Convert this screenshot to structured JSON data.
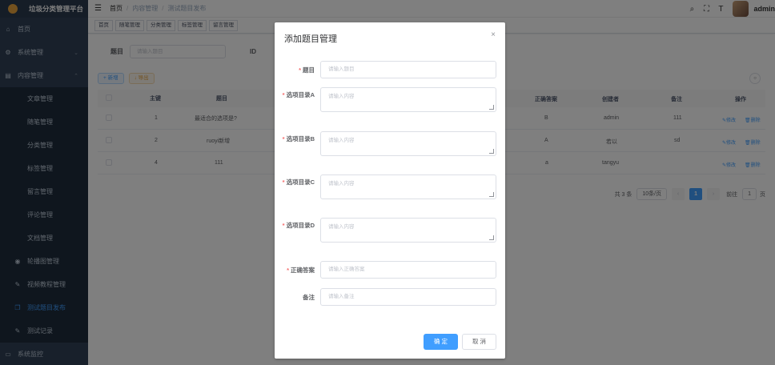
{
  "app": {
    "title": "垃圾分类管理平台"
  },
  "sidebar": {
    "items": [
      {
        "label": "首页",
        "icon": "home-icon"
      },
      {
        "label": "系统管理",
        "icon": "gear-icon"
      },
      {
        "label": "内容管理",
        "icon": "doc-icon"
      },
      {
        "label": "文章管理"
      },
      {
        "label": "随笔管理"
      },
      {
        "label": "分类管理"
      },
      {
        "label": "标签管理"
      },
      {
        "label": "留言管理"
      },
      {
        "label": "评论管理"
      },
      {
        "label": "文档管理"
      },
      {
        "label": "轮播图管理",
        "icon": "image-icon"
      },
      {
        "label": "视频教程管理",
        "icon": "video-icon"
      },
      {
        "label": "测试题目发布",
        "icon": "copy-icon"
      },
      {
        "label": "测试记录",
        "icon": "record-icon"
      },
      {
        "label": "系统监控",
        "icon": "monitor-icon"
      }
    ]
  },
  "navbar": {
    "breadcrumb": [
      "首页",
      "内容管理",
      "测试题目发布"
    ],
    "user": "admin"
  },
  "tags": [
    "首页",
    "随笔管理",
    "分类管理",
    "标签管理",
    "留言管理"
  ],
  "search": {
    "label_title": "题目",
    "placeholder_title": "请输入题目",
    "label_id": "ID"
  },
  "toolbar": {
    "add": "+ 新增",
    "export": "↓ 导出"
  },
  "table": {
    "headers": [
      "主键",
      "题目",
      "正确答案",
      "创建者",
      "备注",
      "操作"
    ],
    "rows": [
      {
        "id": "1",
        "title": "最适合的选项是?",
        "answer": "B",
        "creator": "admin",
        "remark": "111"
      },
      {
        "id": "2",
        "title": "ruoyi新增",
        "answer": "A",
        "creator": "若以",
        "remark": "sd"
      },
      {
        "id": "4",
        "title": "111",
        "answer": "a",
        "creator": "tangyu",
        "remark": ""
      }
    ],
    "edit": "修改",
    "delete": "删除"
  },
  "pager": {
    "total": "共 3 条",
    "size": "10条/页",
    "current": "1",
    "goto": "前往",
    "page_input": "1",
    "page_unit": "页"
  },
  "dialog": {
    "title": "添加题目管理",
    "fields": [
      {
        "label": "题目",
        "placeholder": "请输入题目",
        "required": true
      },
      {
        "label": "选项目录A",
        "placeholder": "请输入内容",
        "required": true
      },
      {
        "label": "选项目录B",
        "placeholder": "请输入内容",
        "required": true
      },
      {
        "label": "选项目录C",
        "placeholder": "请输入内容",
        "required": true
      },
      {
        "label": "选项目录D",
        "placeholder": "请输入内容",
        "required": true
      },
      {
        "label": "正确答案",
        "placeholder": "请输入正确答案",
        "required": true
      },
      {
        "label": "备注",
        "placeholder": "请输入备注",
        "required": false
      }
    ],
    "ok": "确 定",
    "cancel": "取 消"
  },
  "colors": {
    "primary": "#409eff",
    "sidebar": "#304156",
    "danger": "#f56c6c"
  }
}
